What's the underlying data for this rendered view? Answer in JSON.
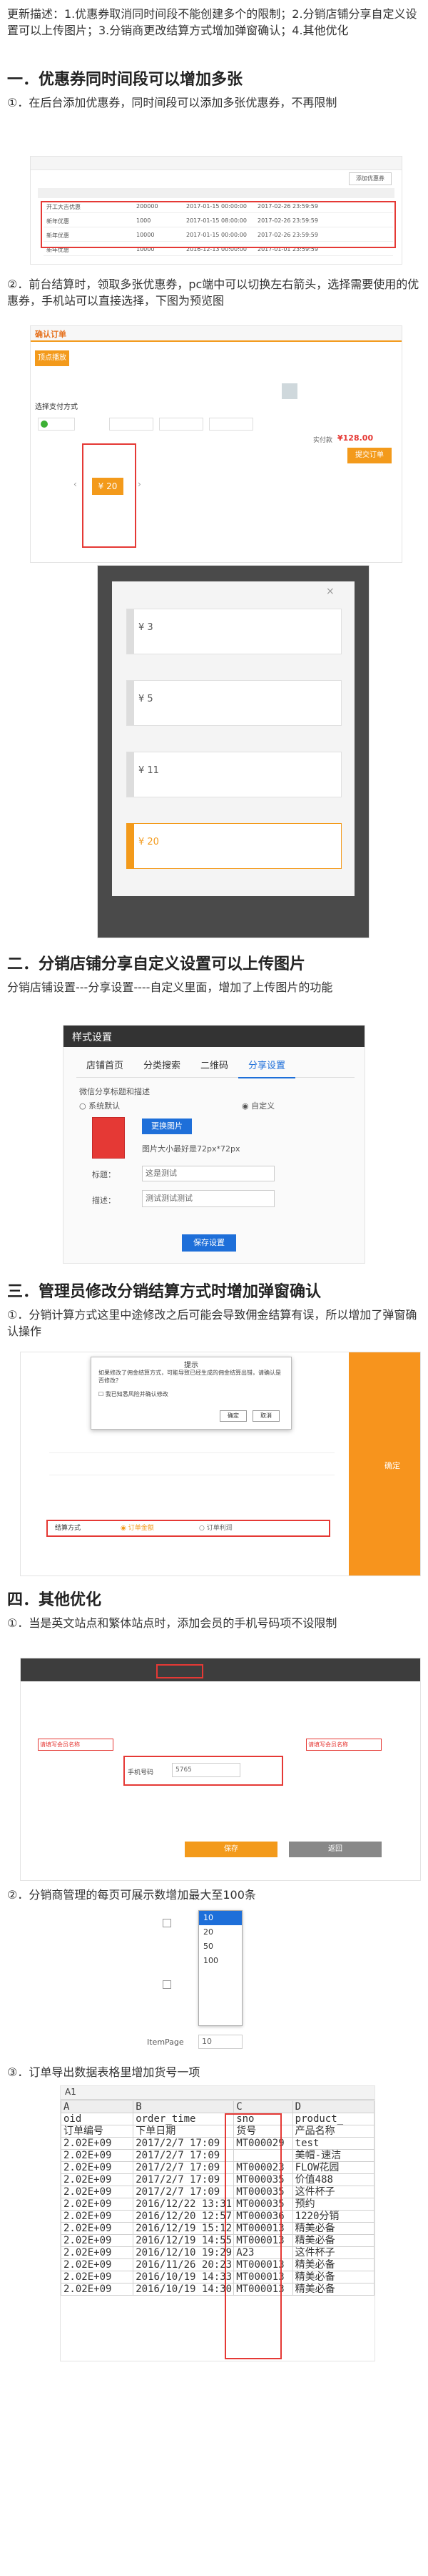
{
  "intro": "更新描述：1.优惠券取消同时间段不能创建多个的限制；2.分销店铺分享自定义设置可以上传图片；3.分销商更改结算方式增加弹窗确认；4.其他优化",
  "sections": {
    "s1": {
      "title": "一．优惠券同时间段可以增加多张",
      "p1": "①．在后台添加优惠券，同时间段可以添加多张优惠券，不再限制",
      "p2": "②．前台结算时，领取多张优惠券，pc端中可以切换左右箭头，选择需要使用的优惠券，手机站可以直接选择，下图为预览图"
    },
    "s2": {
      "title": "二．分销店铺分享自定义设置可以上传图片",
      "p1": "分销店铺设置---分享设置----自定义里面，增加了上传图片的功能"
    },
    "s3": {
      "title": "三．管理员修改分销结算方式时增加弹窗确认",
      "p1": "①．分销计算方式这里中途修改之后可能会导致佣金结算有误，所以增加了弹窗确认操作"
    },
    "s4": {
      "title": "四．其他优化",
      "p1": "①．当是英文站点和繁体站点时，添加会员的手机号码项不设限制",
      "p2": "②．分销商管理的每页可展示数增加最大至100条",
      "p3": "③．订单导出数据表格里增加货号一项"
    }
  },
  "coupon_admin": {
    "add_button": "添加优惠券",
    "rows": [
      {
        "name": "开工大吉优惠",
        "count": "200000",
        "start": "2017-01-15 00:00:00",
        "end": "2017-02-26 23:59:59"
      },
      {
        "name": "新年优惠",
        "count": "1000",
        "start": "2017-01-15 08:00:00",
        "end": "2017-02-26 23:59:59"
      },
      {
        "name": "新年优惠",
        "count": "10000",
        "start": "2017-01-15 00:00:00",
        "end": "2017-02-26 23:59:59"
      },
      {
        "name": "新年优惠",
        "count": "10000",
        "start": "2016-12-13 00:00:00",
        "end": "2017-01-01 23:59:59"
      }
    ]
  },
  "checkout": {
    "header": "确认订单",
    "shop": "顶点播放",
    "coupon_value": "¥ 20",
    "pay_title": "选择支付方式",
    "total_label": "实付款",
    "total_value": "¥128.00",
    "submit": "提交订单"
  },
  "mobile_coupons": [
    "¥ 3",
    "¥ 5",
    "¥ 11",
    "¥ 20"
  ],
  "share_dialog": {
    "title": "样式设置",
    "tabs": [
      "店铺首页",
      "分类搜索",
      "二维码",
      "分享设置"
    ],
    "section_label": "微信分享标题和描述",
    "opt_system": "系统默认",
    "opt_custom": "自定义",
    "upload_button": "更换图片",
    "size_hint": "图片大小最好是72px*72px",
    "title_label": "标题：",
    "title_value": "这是测试",
    "desc_label": "描述：",
    "desc_value": "测试测试测试",
    "save_button": "保存设置"
  },
  "settle_confirm": {
    "dialog_title": "提示",
    "dialog_text": "如果修改了佣金结算方式，可能导致已经生成的佣金结算出错，请确认是否修改？",
    "dialog_check": "我已知悉风险并确认修改",
    "ok": "确定",
    "cancel": "取消",
    "method_label": "结算方式",
    "opt_order": "订单金额",
    "opt_profit": "订单利润",
    "side_button": "确定"
  },
  "member_form": {
    "mobile_label": "手机号码",
    "mobile_value": "5765",
    "note_left": "请填写会员名称",
    "note_right": "请填写会员名称",
    "save": "保存",
    "back": "返回"
  },
  "pagesize": {
    "options": [
      "10",
      "20",
      "50",
      "100"
    ],
    "selected": "10",
    "label": "ItemPage"
  },
  "excel": {
    "cell_ref": "A1",
    "columns": [
      "A",
      "B",
      "C",
      "D"
    ],
    "header_en": [
      "oid",
      "order_time",
      "sno",
      "product_"
    ],
    "header_cn": [
      "订单编号",
      "下单日期",
      "货号",
      "产品名称"
    ],
    "rows": [
      [
        "2.02E+09",
        "2017/2/7 17:09",
        "MT000029",
        "test"
      ],
      [
        "2.02E+09",
        "2017/2/7 17:09",
        "",
        "美帽-速洁"
      ],
      [
        "2.02E+09",
        "2017/2/7 17:09",
        "MT000023",
        "FLOW花园"
      ],
      [
        "2.02E+09",
        "2017/2/7 17:09",
        "MT000035",
        "价值488"
      ],
      [
        "2.02E+09",
        "2017/2/7 17:09",
        "MT000035",
        "这件杯子"
      ],
      [
        "2.02E+09",
        "2016/12/22 13:31",
        "MT000035",
        "预约"
      ],
      [
        "2.02E+09",
        "2016/12/20 12:57",
        "MT000036",
        "1220分销"
      ],
      [
        "2.02E+09",
        "2016/12/19 15:12",
        "MT000013",
        "精美必备"
      ],
      [
        "2.02E+09",
        "2016/12/19 14:55",
        "MT000013",
        "精美必备"
      ],
      [
        "2.02E+09",
        "2016/12/10 19:29",
        "A23",
        "这件杯子"
      ],
      [
        "2.02E+09",
        "2016/11/26 20:23",
        "MT000013",
        "精美必备"
      ],
      [
        "2.02E+09",
        "2016/10/19 14:33",
        "MT000013",
        "精美必备"
      ],
      [
        "2.02E+09",
        "2016/10/19 14:30",
        "MT000013",
        "精美必备"
      ]
    ]
  }
}
